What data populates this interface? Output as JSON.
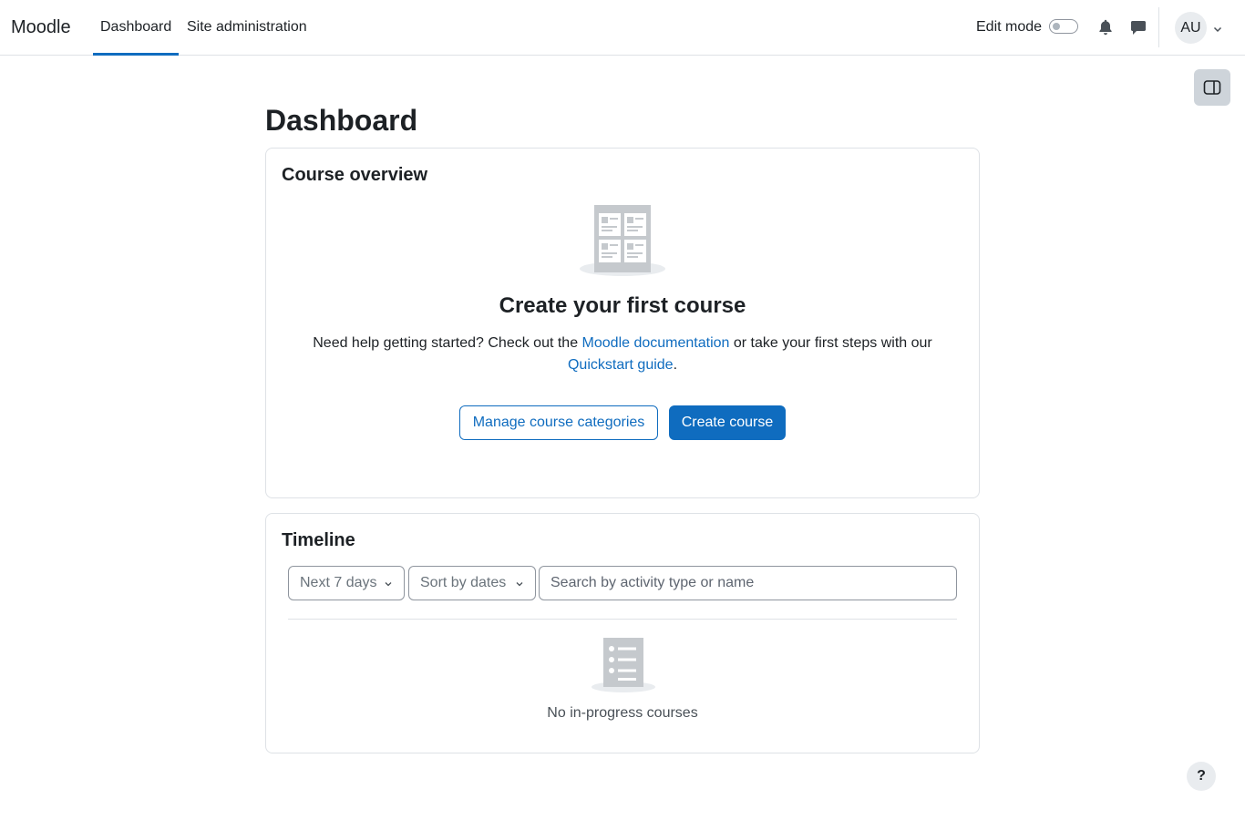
{
  "navbar": {
    "brand": "Moodle",
    "tabs": [
      {
        "label": "Dashboard",
        "active": true
      },
      {
        "label": "Site administration",
        "active": false
      }
    ],
    "edit_mode_label": "Edit mode",
    "edit_mode_on": false,
    "notifications_icon": "bell-icon",
    "messages_icon": "chat-icon",
    "user_initials": "AU"
  },
  "page": {
    "title": "Dashboard"
  },
  "course_overview": {
    "title": "Course overview",
    "heading": "Create your first course",
    "help_prefix": "Need help getting started? Check out the ",
    "doc_link": "Moodle documentation",
    "help_middle": " or take your first steps with our ",
    "quickstart_link": "Quickstart guide",
    "help_suffix": ".",
    "manage_button": "Manage course categories",
    "create_button": "Create course"
  },
  "timeline": {
    "title": "Timeline",
    "range_select": "Next 7 days",
    "sort_select": "Sort by dates",
    "search_placeholder": "Search by activity type or name",
    "empty_text": "No in-progress courses"
  },
  "help_button": "?",
  "colors": {
    "accent": "#0f6cbf",
    "border": "#dee2e6",
    "illustration": "#c5c9cd"
  }
}
